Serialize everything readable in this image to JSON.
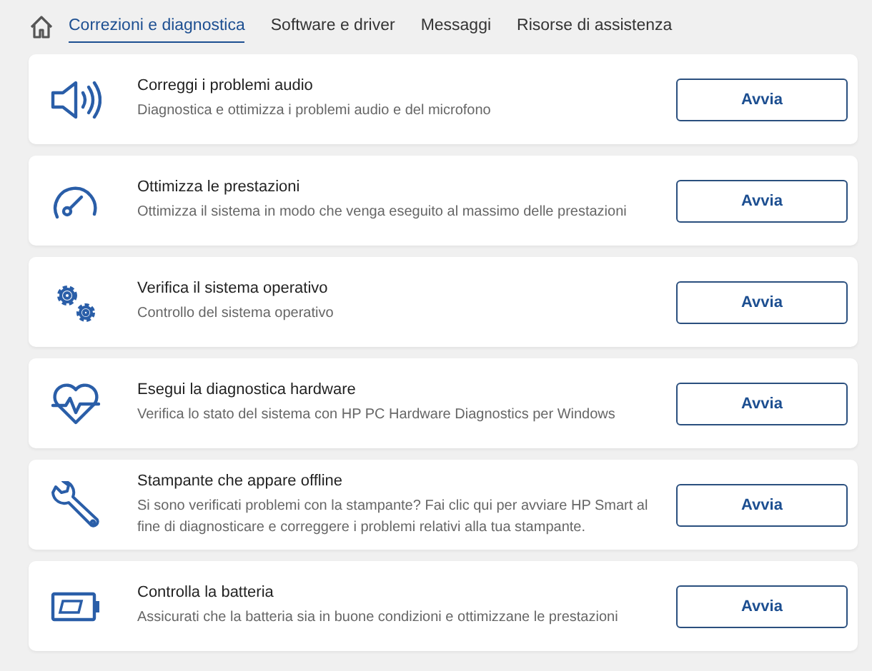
{
  "tabs": [
    {
      "label": "Correzioni e diagnostica",
      "selected": true
    },
    {
      "label": "Software e driver",
      "selected": false
    },
    {
      "label": "Messaggi",
      "selected": false
    },
    {
      "label": "Risorse di assistenza",
      "selected": false
    }
  ],
  "cards": [
    {
      "kind": "speaker",
      "title": "Correggi i problemi audio",
      "description": "Diagnostica e ottimizza i problemi audio e del microfono",
      "button": "Avvia"
    },
    {
      "kind": "gauge",
      "title": "Ottimizza le prestazioni",
      "description": "Ottimizza il sistema in modo che venga eseguito al massimo delle prestazioni",
      "button": "Avvia"
    },
    {
      "kind": "gears",
      "title": "Verifica il sistema operativo",
      "description": "Controllo del sistema operativo",
      "button": "Avvia"
    },
    {
      "kind": "heart",
      "title": "Esegui la diagnostica hardware",
      "description": "Verifica lo stato del sistema con HP PC Hardware Diagnostics per Windows",
      "button": "Avvia"
    },
    {
      "kind": "wrench",
      "title": "Stampante che appare offline",
      "description": "Si sono verificati problemi con la stampante? Fai clic qui per avviare HP Smart al fine di diagnosticare e correggere i problemi relativi alla tua stampante.",
      "button": "Avvia"
    },
    {
      "kind": "battery",
      "title": "Controlla la batteria",
      "description": "Assicurati che la batteria sia in buone condizioni e ottimizzane le prestazioni",
      "button": "Avvia"
    }
  ]
}
